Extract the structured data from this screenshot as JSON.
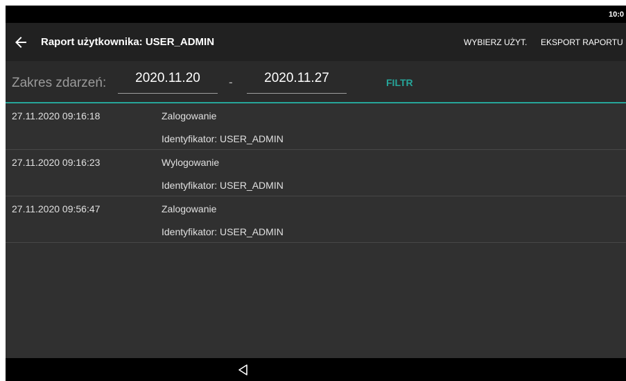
{
  "status_bar": {
    "time": "10:0"
  },
  "app_bar": {
    "title": "Raport użytkownika: USER_ADMIN",
    "action_select_user": "WYBIERZ UŻYT.",
    "action_export": "EKSPORT RAPORTU"
  },
  "filter": {
    "label": "Zakres zdarzeń:",
    "date_from": "2020.11.20",
    "separator": "-",
    "date_to": "2020.11.27",
    "button": "FILTR"
  },
  "entries": [
    {
      "datetime": "27.11.2020 09:16:18",
      "event": "Zalogowanie",
      "identifier": "Identyfikator: USER_ADMIN"
    },
    {
      "datetime": "27.11.2020 09:16:23",
      "event": "Wylogowanie",
      "identifier": "Identyfikator: USER_ADMIN"
    },
    {
      "datetime": "27.11.2020 09:56:47",
      "event": "Zalogowanie",
      "identifier": "Identyfikator: USER_ADMIN"
    }
  ],
  "colors": {
    "accent": "#26a69a",
    "background": "#303030",
    "app_bar": "#212121"
  }
}
